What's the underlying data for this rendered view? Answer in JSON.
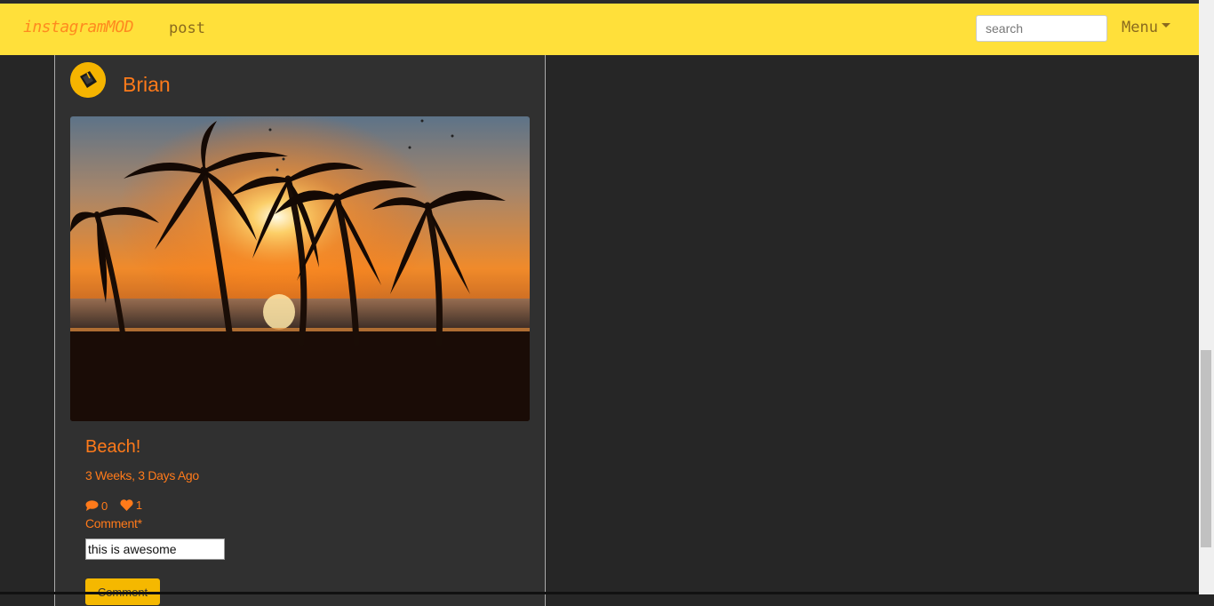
{
  "navbar": {
    "brand": "instagramMOD",
    "post_link": "post",
    "search_placeholder": "search",
    "menu_label": "Menu"
  },
  "post": {
    "username": "Brian",
    "title": "Beach!",
    "time_ago": "3 Weeks, 3 Days Ago",
    "comment_count": "0",
    "like_count": "1",
    "comment_label": "Comment*",
    "comment_value": "this is awesome",
    "comment_button": "Comment"
  },
  "colors": {
    "navbar_bg": "#ffe03a",
    "accent": "#ff7a1a",
    "page_bg": "#262626",
    "card_bg": "#303030",
    "button_bg": "#f5b800"
  },
  "icons": {
    "comment": "speech-bubble-icon",
    "like": "heart-icon",
    "menu": "caret-down-icon"
  }
}
